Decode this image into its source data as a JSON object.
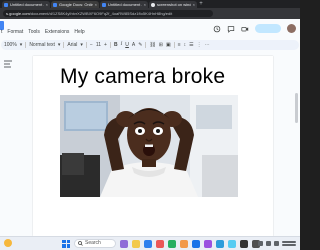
{
  "browser": {
    "tabs": [
      {
        "title": "Untitled document - Google Docs",
        "favicon": "docs-icon",
        "active": false
      },
      {
        "title": "Google Docs: Online Docu...",
        "favicon": "docs-icon",
        "active": true
      },
      {
        "title": "Untitled document - Goog...",
        "favicon": "docs-icon",
        "active": false
      },
      {
        "title": "screenshot on windows - G...",
        "favicon": "google-icon",
        "active": false
      }
    ],
    "url_host": "s.google.com",
    "url_path": "/document/d/1ZS8K4yIhtvrXZWBXF6O9Fq2f_4oaRW85Sdz1fIo5K4HnH8hg/edit"
  },
  "docs": {
    "menu": [
      "t",
      "Format",
      "Tools",
      "Extensions",
      "Help"
    ],
    "toolbar": {
      "zoom": "100%",
      "style": "Normal text",
      "font": "Arial",
      "font_size": "11",
      "minus": "−",
      "plus": "+",
      "bold": "B",
      "italic": "I",
      "underline": "U",
      "text_color": "A"
    }
  },
  "document": {
    "heading": "My camera broke"
  },
  "taskbar": {
    "search_label": "Search"
  },
  "colors": {
    "accent": "#1a73e8",
    "docs_blue": "#4285f4",
    "share_button": "#c2e7ff"
  }
}
